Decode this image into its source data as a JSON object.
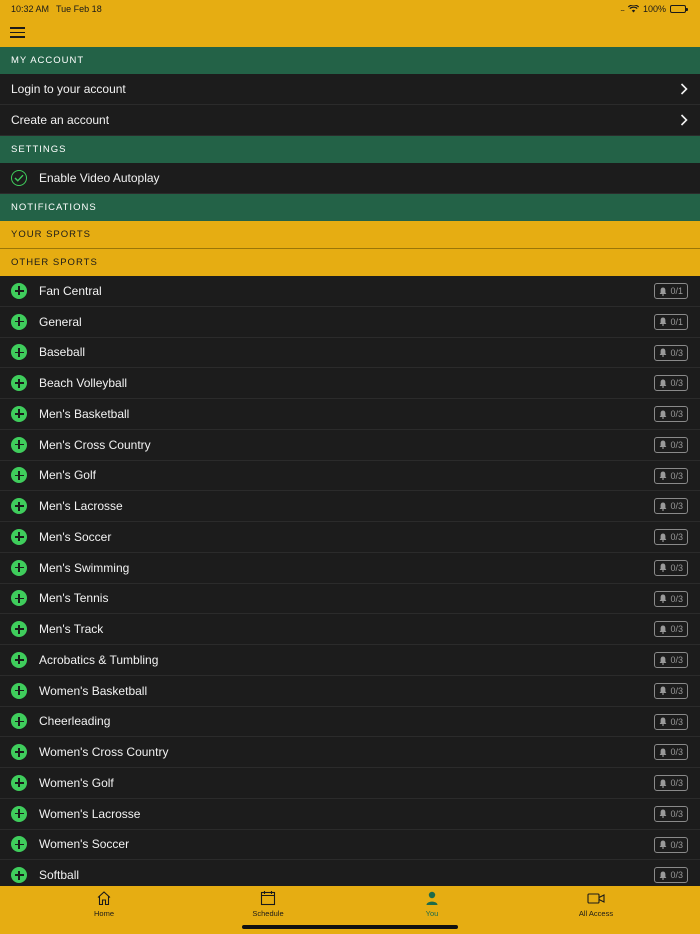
{
  "status_bar": {
    "time": "10:32 AM",
    "date": "Tue Feb 18",
    "battery": "100%"
  },
  "my_account": {
    "header": "MY ACCOUNT",
    "items": [
      {
        "label": "Login to your account"
      },
      {
        "label": "Create an account"
      }
    ]
  },
  "settings": {
    "header": "SETTINGS",
    "autoplay_label": "Enable Video Autoplay",
    "autoplay_enabled": true
  },
  "notifications": {
    "header": "NOTIFICATIONS"
  },
  "your_sports": {
    "header": "YOUR SPORTS"
  },
  "other_sports": {
    "header": "OTHER SPORTS",
    "items": [
      {
        "name": "Fan Central",
        "count": "0/1"
      },
      {
        "name": "General",
        "count": "0/1"
      },
      {
        "name": "Baseball",
        "count": "0/3"
      },
      {
        "name": "Beach Volleyball",
        "count": "0/3"
      },
      {
        "name": "Men's Basketball",
        "count": "0/3"
      },
      {
        "name": "Men's Cross Country",
        "count": "0/3"
      },
      {
        "name": "Men's Golf",
        "count": "0/3"
      },
      {
        "name": "Men's Lacrosse",
        "count": "0/3"
      },
      {
        "name": "Men's Soccer",
        "count": "0/3"
      },
      {
        "name": "Men's Swimming",
        "count": "0/3"
      },
      {
        "name": "Men's Tennis",
        "count": "0/3"
      },
      {
        "name": "Men's Track",
        "count": "0/3"
      },
      {
        "name": "Acrobatics & Tumbling",
        "count": "0/3"
      },
      {
        "name": "Women's Basketball",
        "count": "0/3"
      },
      {
        "name": "Cheerleading",
        "count": "0/3"
      },
      {
        "name": "Women's Cross Country",
        "count": "0/3"
      },
      {
        "name": "Women's Golf",
        "count": "0/3"
      },
      {
        "name": "Women's Lacrosse",
        "count": "0/3"
      },
      {
        "name": "Women's Soccer",
        "count": "0/3"
      },
      {
        "name": "Softball",
        "count": "0/3"
      }
    ]
  },
  "tabbar": {
    "tabs": [
      {
        "label": "Home",
        "icon": "home-icon"
      },
      {
        "label": "Schedule",
        "icon": "calendar-icon"
      },
      {
        "label": "You",
        "icon": "person-icon",
        "active": true
      },
      {
        "label": "All Access",
        "icon": "video-camera-icon"
      }
    ]
  },
  "colors": {
    "accent_yellow": "#e6ad12",
    "section_green": "#236247",
    "plus_green": "#3fcd5c",
    "row_bg": "#1c1c1c"
  }
}
